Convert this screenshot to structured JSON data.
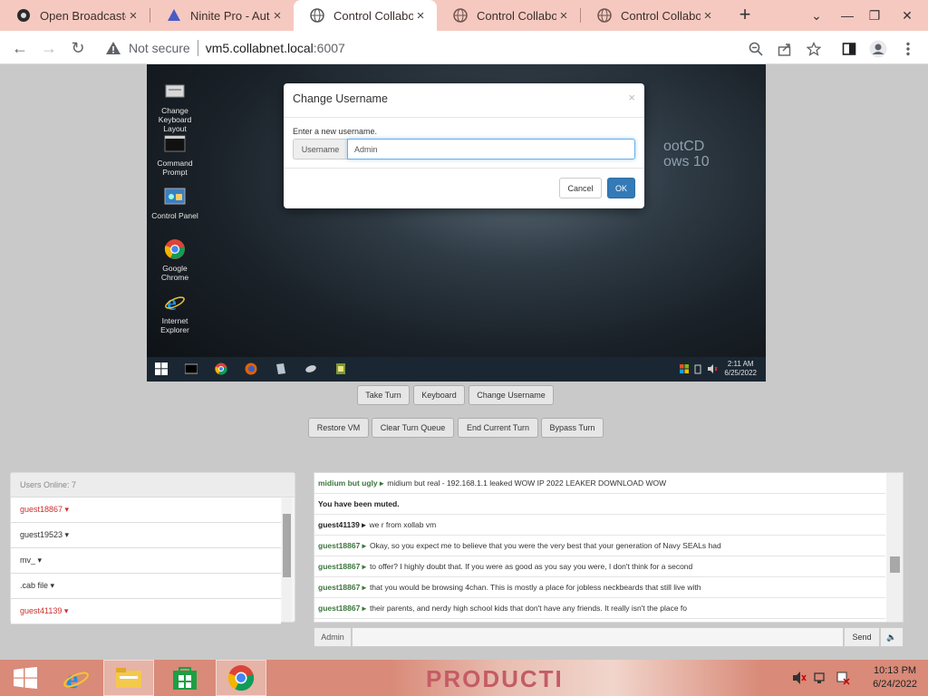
{
  "browser": {
    "tabs": [
      {
        "title": "Open Broadcaster",
        "icon": "obs-icon",
        "active": false
      },
      {
        "title": "Ninite Pro - Auto",
        "icon": "ninite-icon",
        "active": false
      },
      {
        "title": "Control Collabora",
        "icon": "globe-icon",
        "active": true
      },
      {
        "title": "Control Collabora",
        "icon": "globe-icon",
        "active": false
      },
      {
        "title": "Control Collabora",
        "icon": "globe-icon",
        "active": false
      }
    ],
    "security": "Not secure",
    "url_host": "vm5.collabnet.local",
    "url_port": ":6007"
  },
  "vm": {
    "desktop_icons": [
      {
        "label": "Change Keyboard Layout",
        "icon": "keyboard-icon"
      },
      {
        "label": "Command Prompt",
        "icon": "cmd-icon"
      },
      {
        "label": "Control Panel",
        "icon": "control-panel-icon"
      },
      {
        "label": "Google Chrome",
        "icon": "chrome-icon"
      },
      {
        "label": "Internet Explorer",
        "icon": "ie-icon"
      }
    ],
    "wallpaper_text_1": "ootCD",
    "wallpaper_text_2": "ows 10",
    "clock_time": "2:11 AM",
    "clock_date": "6/25/2022"
  },
  "dialog": {
    "title": "Change Username",
    "close": "×",
    "prompt": "Enter a new username.",
    "addon": "Username",
    "value": "Admin",
    "cancel": "Cancel",
    "ok": "OK"
  },
  "controls": {
    "row1": [
      "Take Turn",
      "Keyboard",
      "Change Username"
    ],
    "row2": [
      "Restore VM",
      "Clear Turn Queue",
      "End Current Turn",
      "Bypass Turn"
    ]
  },
  "users": {
    "header": "Users Online: 7",
    "list": [
      {
        "name": "guest18867 ▾",
        "red": true
      },
      {
        "name": "guest19523 ▾",
        "red": false
      },
      {
        "name": "mv_ ▾",
        "red": false
      },
      {
        "name": ".cab file ▾",
        "red": false
      },
      {
        "name": "guest41139 ▾",
        "red": true
      }
    ]
  },
  "chat": {
    "messages": [
      {
        "name": "midium but ugly ▸",
        "text": "midium but real - 192.168.1.1 leaked WOW IP 2022 LEAKER DOWNLOAD WOW",
        "bold": false
      },
      {
        "name": "",
        "text": "You have been muted.",
        "bold": true
      },
      {
        "name": "guest41139 ▸",
        "text": "we r from xollab vm",
        "bold": false,
        "dark": true
      },
      {
        "name": "guest18867 ▸",
        "text": "Okay, so you expect me to believe that you were the very best that your generation of Navy SEALs had",
        "bold": false
      },
      {
        "name": "guest18867 ▸",
        "text": "to offer? I highly doubt that. If you were as good as you say you were, I don't think for a second",
        "bold": false
      },
      {
        "name": "guest18867 ▸",
        "text": "that you would be browsing 4chan. This is mostly a place for jobless neckbeards that still live with",
        "bold": false
      },
      {
        "name": "guest18867 ▸",
        "text": "their parents, and nerdy high school kids that don't have any friends. It really isn't the place fo",
        "bold": false
      }
    ],
    "username": "Admin",
    "send": "Send",
    "volume": "🔈"
  },
  "taskbar": {
    "wallpaper_text": "PRODUCTI",
    "time": "10:13 PM",
    "date": "6/24/2022"
  }
}
